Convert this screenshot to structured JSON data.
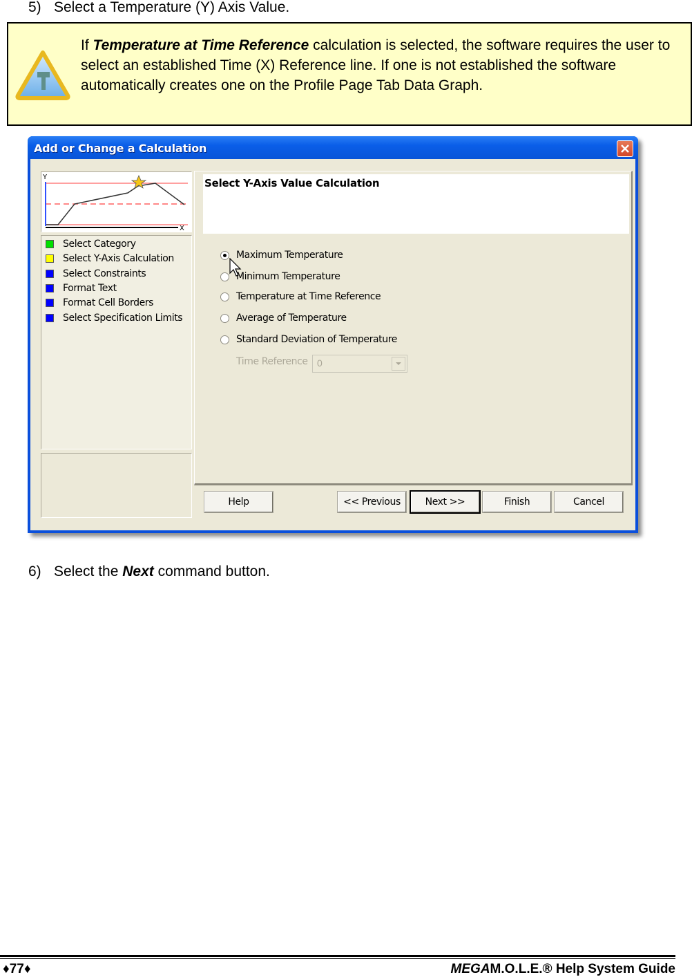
{
  "steps": [
    {
      "number": "5)",
      "text": "Select a Temperature (Y) Axis Value."
    },
    {
      "number": "6)",
      "text_before": "Select the ",
      "emphasis": "Next",
      "text_after": " command button."
    }
  ],
  "note": {
    "icon": "tip-triangle-icon",
    "prefix": "If ",
    "emphasis": "Temperature at Time Reference",
    "body": " calculation is selected, the software requires the user to select an established Time (X) Reference line. If one is not established the software automatically creates one on the Profile Page Tab Data Graph."
  },
  "dialog": {
    "title": "Add or Change a Calculation",
    "close_icon": "close-icon",
    "graph": {
      "y_label": "Y",
      "x_label": "X"
    },
    "wizard_steps": [
      {
        "label": "Select Category",
        "color": "#00e000"
      },
      {
        "label": "Select Y-Axis Calculation",
        "color": "#ffff00"
      },
      {
        "label": "Select Constraints",
        "color": "#0000ff"
      },
      {
        "label": "Format Text",
        "color": "#0000ff"
      },
      {
        "label": "Format Cell Borders",
        "color": "#0000ff"
      },
      {
        "label": "Select Specification Limits",
        "color": "#0000ff"
      }
    ],
    "panel_title": "Select Y-Axis Value Calculation",
    "options": [
      {
        "label": "Maximum Temperature",
        "selected": true
      },
      {
        "label": "Minimum Temperature",
        "selected": false
      },
      {
        "label": "Temperature at Time Reference",
        "selected": false
      },
      {
        "label": "Average of Temperature",
        "selected": false
      },
      {
        "label": "Standard Deviation of Temperature",
        "selected": false
      }
    ],
    "time_reference": {
      "label": "Time Reference",
      "value": "0",
      "enabled": false
    },
    "buttons": {
      "help": "Help",
      "previous": "<< Previous",
      "next": "Next >>",
      "finish": "Finish",
      "cancel": "Cancel"
    }
  },
  "footer": {
    "page": "♦77♦",
    "brand_italic": "MEGA",
    "brand_rest": "M.O.L.E.® Help System Guide"
  }
}
